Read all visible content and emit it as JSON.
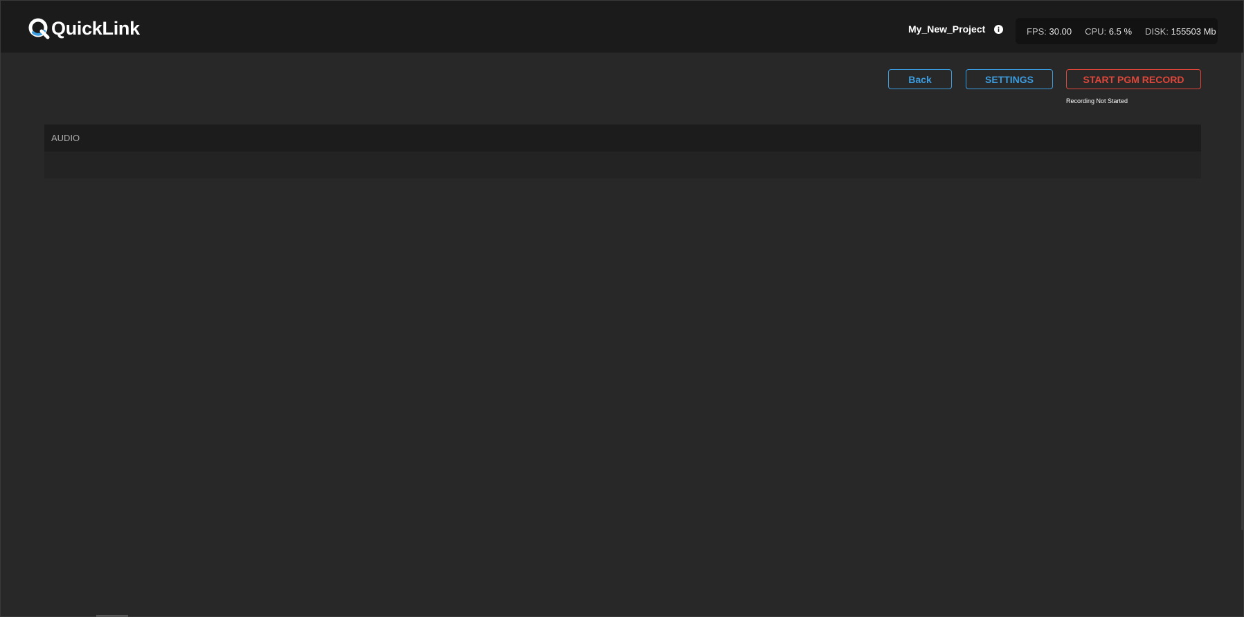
{
  "app": {
    "brand_name": "QuickLink"
  },
  "header": {
    "project_name": "My_New_Project",
    "stats": {
      "fps_label": "FPS:",
      "fps_value": "30.00",
      "cpu_label": "CPU:",
      "cpu_value": "6.5 %",
      "disk_label": "DISK:",
      "disk_value": "155503 Mb"
    }
  },
  "toolbar": {
    "back_label": "Back",
    "settings_label": "SETTINGS",
    "record_label": "START PGM RECORD",
    "record_status": "Recording Not Started"
  },
  "audio_panel": {
    "title": "AUDIO"
  },
  "colors": {
    "accent_blue": "#3b9de0",
    "record_red": "#e0473b",
    "header_bg": "#1b1b1b",
    "page_bg": "#282828"
  },
  "icons": {
    "logo": "quicklink-logo-icon",
    "project_info": "info-icon"
  }
}
